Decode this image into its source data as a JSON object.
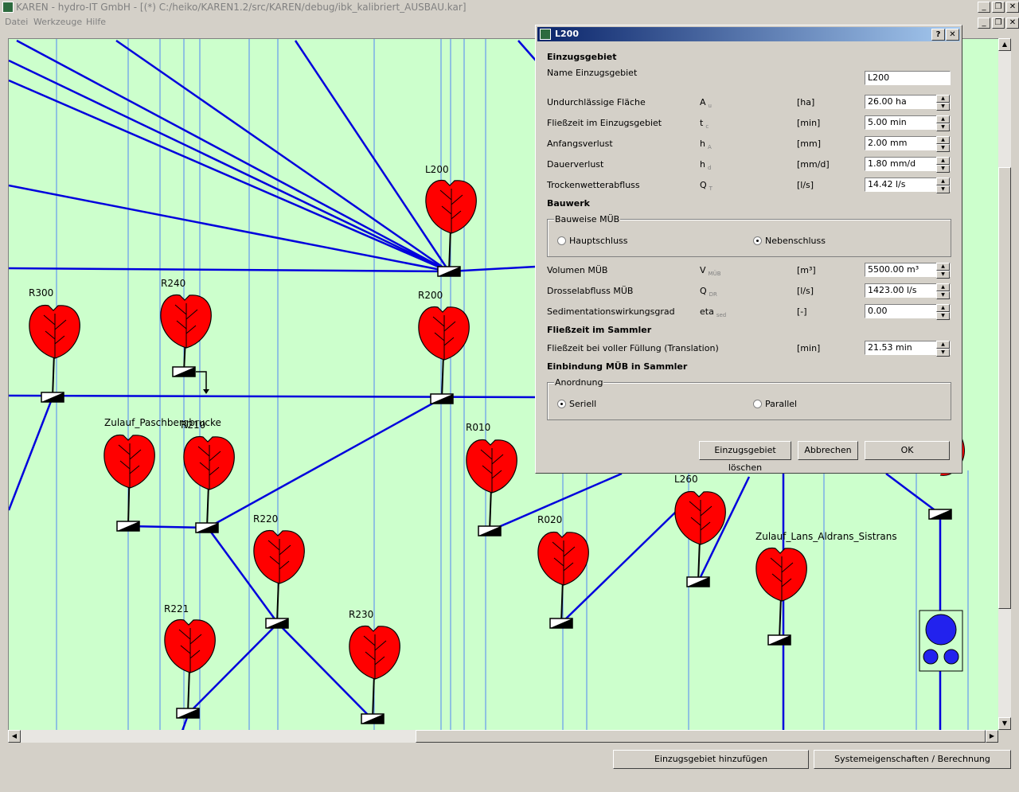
{
  "window": {
    "title": "KAREN - hydro-IT GmbH - [(*) C:/heiko/KAREN1.2/src/KAREN/debug/ibk_kalibriert_AUSBAU.kar]"
  },
  "menu": {
    "items": [
      "Datei",
      "Werkzeuge",
      "Hilfe"
    ]
  },
  "canvas": {
    "nodes": [
      "L200",
      "R300",
      "R240",
      "R200",
      "Zulauf_Paschbergbrucke",
      "R210",
      "R010",
      "R220",
      "R020",
      "L260",
      "Zulauf_Lans_Aldrans_Sistrans",
      "R221",
      "R230"
    ]
  },
  "dialog": {
    "title": "L200",
    "help": "?",
    "close": "✕",
    "sections": {
      "einzugsgebiet": "Einzugsgebiet",
      "bauwerk": "Bauwerk",
      "fliesszeit": "Fließzeit im Sammler",
      "einbindung": "Einbindung MÜB in Sammler"
    },
    "name_label": "Name Einzugsgebiet",
    "name_value": "L200",
    "rows": [
      {
        "label": "Undurchlässige Fläche",
        "sym": "A",
        "sub": "u",
        "unit": "[ha]",
        "value": "26.00 ha"
      },
      {
        "label": "Fließzeit im Einzugsgebiet",
        "sym": "t",
        "sub": "c",
        "unit": "[min]",
        "value": "5.00 min"
      },
      {
        "label": "Anfangsverlust",
        "sym": "h",
        "sub": "A",
        "unit": "[mm]",
        "value": "2.00 mm"
      },
      {
        "label": "Dauerverlust",
        "sym": "h",
        "sub": "d",
        "unit": "[mm/d]",
        "value": "1.80 mm/d"
      },
      {
        "label": "Trockenwetterabfluss",
        "sym": "Q",
        "sub": "T",
        "unit": "[l/s]",
        "value": "14.42 l/s"
      }
    ],
    "bauweise": {
      "legend": "Bauweise MÜB",
      "opt1": "Hauptschluss",
      "opt2": "Nebenschluss",
      "selected": "Nebenschluss"
    },
    "rows2": [
      {
        "label": "Volumen MÜB",
        "sym": "V",
        "sub": "MÜB",
        "unit": "[m³]",
        "value": "5500.00 m³"
      },
      {
        "label": "Drosselabfluss MÜB",
        "sym": "Q",
        "sub": "DR",
        "unit": "[l/s]",
        "value": "1423.00 l/s"
      },
      {
        "label": "Sedimentationswirkungsgrad",
        "sym": "eta",
        "sub": "sed",
        "unit": "[-]",
        "value": "0.00"
      }
    ],
    "fliess_row": {
      "label": "Fließzeit bei voller Füllung (Translation)",
      "unit": "[min]",
      "value": "21.53 min"
    },
    "anordnung": {
      "legend": "Anordnung",
      "opt1": "Seriell",
      "opt2": "Parallel",
      "selected": "Seriell"
    },
    "buttons": {
      "delete": "Einzugsgebiet löschen",
      "cancel": "Abbrechen",
      "ok": "OK"
    }
  },
  "bottom_buttons": {
    "add": "Einzugsgebiet hinzufügen",
    "system": "Systemeigenschaften / Berechnung"
  },
  "colors": {
    "canvas": "#ccffcc",
    "pipe": "#0000dd",
    "tree": "#ff0000",
    "grid": "#3366ff"
  }
}
